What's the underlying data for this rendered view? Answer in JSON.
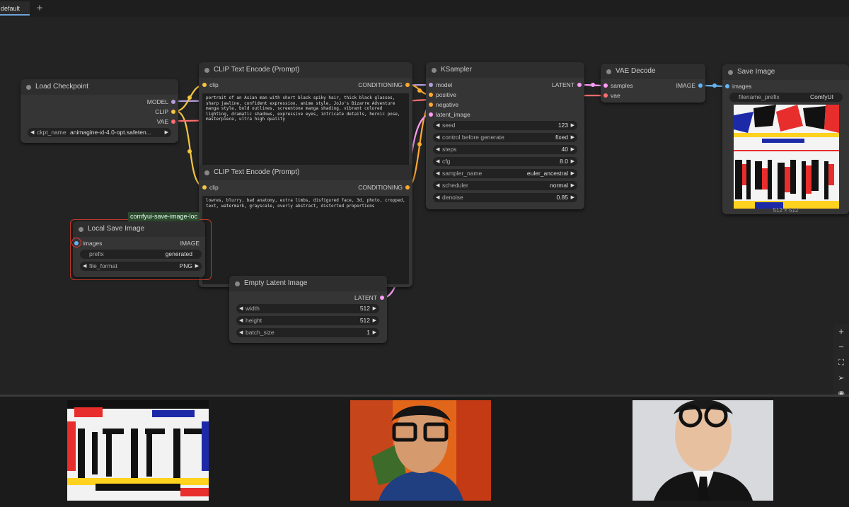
{
  "tabs": [
    {
      "label": "default"
    }
  ],
  "tab_add_label": "+",
  "group_label": "comfyui-save-image-loc",
  "nodes": {
    "load_checkpoint": {
      "title": "Load Checkpoint",
      "outputs": [
        "MODEL",
        "CLIP",
        "VAE"
      ],
      "widgets": [
        {
          "label": "ckpt_name",
          "value": "animagine-xl-4.0-opt.safeten..."
        }
      ]
    },
    "clip_pos": {
      "title": "CLIP Text Encode (Prompt)",
      "input": "clip",
      "output": "CONDITIONING",
      "text": "portrait of an Asian man with short black spiky hair, thick black glasses, sharp jawline, confident expression, anime style, JoJo's Bizarre Adventure manga style, bold outlines, screentone manga shading, vibrant colored lighting, dramatic shadows, expressive eyes, intricate details, heroic pose, masterpiece, ultra high quality"
    },
    "clip_neg": {
      "title": "CLIP Text Encode (Prompt)",
      "input": "clip",
      "output": "CONDITIONING",
      "text": "lowres, blurry, bad anatomy, extra limbs, disfigured face, 3d, photo, cropped, text, watermark, grayscale, overly abstract, distorted proportions"
    },
    "ksampler": {
      "title": "KSampler",
      "inputs": [
        "model",
        "positive",
        "negative",
        "latent_image"
      ],
      "output": "LATENT",
      "widgets": [
        {
          "label": "seed",
          "value": "123"
        },
        {
          "label": "control before generate",
          "value": "fixed"
        },
        {
          "label": "steps",
          "value": "40"
        },
        {
          "label": "cfg",
          "value": "8.0"
        },
        {
          "label": "sampler_name",
          "value": "euler_ancestral"
        },
        {
          "label": "scheduler",
          "value": "normal"
        },
        {
          "label": "denoise",
          "value": "0.85"
        }
      ]
    },
    "vae_decode": {
      "title": "VAE Decode",
      "inputs": [
        "samples",
        "vae"
      ],
      "output": "IMAGE"
    },
    "save_image": {
      "title": "Save Image",
      "input": "images",
      "widgets": [
        {
          "label": "filename_prefix",
          "value": "ComfyUI"
        }
      ],
      "preview_caption": "512 × 512"
    },
    "local_save": {
      "title": "Local Save Image",
      "input": "images",
      "output": "IMAGE",
      "widgets": [
        {
          "label": "prefix",
          "value": "generated"
        },
        {
          "label": "file_format",
          "value": "PNG"
        }
      ]
    },
    "empty_latent": {
      "title": "Empty Latent Image",
      "output": "LATENT",
      "widgets": [
        {
          "label": "width",
          "value": "512"
        },
        {
          "label": "height",
          "value": "512"
        },
        {
          "label": "batch_size",
          "value": "1"
        }
      ]
    }
  },
  "zoom_controls": [
    "zoom-in",
    "zoom-out",
    "fit-view",
    "navigate",
    "toggle-visibility"
  ],
  "colors": {
    "model_link": "#b39ddb",
    "clip_link": "#f5c542",
    "vae_link": "#ff6e6e",
    "latent_link": "#ff9cf9",
    "image_link": "#64b5f6",
    "conditioning_link": "#ffa931"
  }
}
